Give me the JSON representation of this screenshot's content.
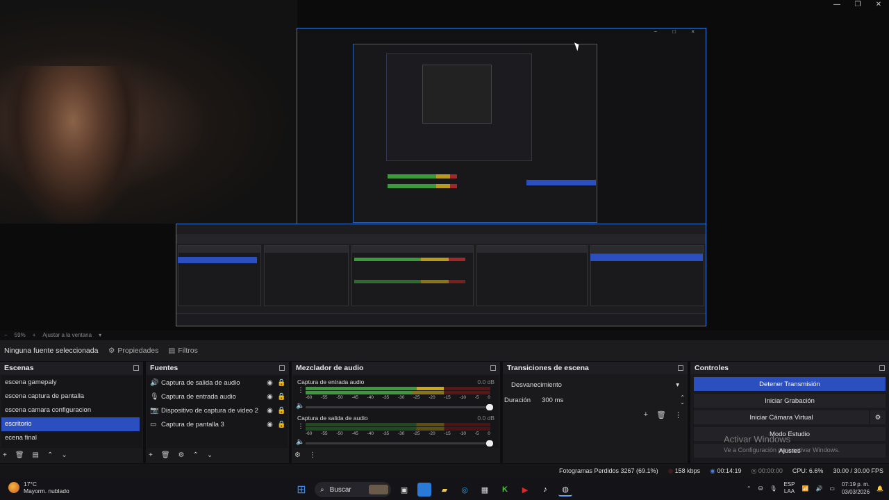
{
  "window": {
    "controls": [
      "—",
      "❐",
      "✕"
    ]
  },
  "zoom": {
    "minus": "−",
    "value": "59%",
    "plus": "+",
    "fit_label": "Ajustar a la ventana",
    "caret": "▾"
  },
  "source_toolbar": {
    "no_source": "Ninguna fuente seleccionada",
    "properties": "Propiedades",
    "filters": "Filtros"
  },
  "scenes": {
    "title": "Escenas",
    "items": [
      "escena gamepaly",
      "escena captura de pantalla",
      "escena camara configuracion",
      "escritorio",
      "ecena final"
    ],
    "active_index": 3
  },
  "sources": {
    "title": "Fuentes",
    "items": [
      {
        "label": "Captura de salida de audio",
        "icon": "speaker-icon"
      },
      {
        "label": "Captura de entrada audio",
        "icon": "microphone-icon"
      },
      {
        "label": "Dispositivo de captura de video 2",
        "icon": "camera-icon"
      },
      {
        "label": "Captura de pantalla 3",
        "icon": "monitor-icon"
      }
    ]
  },
  "mixer": {
    "title": "Mezclador de audio",
    "channels": [
      {
        "name": "Captura de entrada audio",
        "db": "0.0 dB",
        "level": 0.75
      },
      {
        "name": "Captura de salida de audio",
        "db": "0.0 dB",
        "level": 0.0
      }
    ],
    "ticks": [
      "-60",
      "-55",
      "-50",
      "-45",
      "-40",
      "-35",
      "-30",
      "-25",
      "-20",
      "-15",
      "-10",
      "-5",
      "0"
    ]
  },
  "transitions": {
    "title": "Transiciones de escena",
    "selected": "Desvanecimiento",
    "duration_label": "Duración",
    "duration_value": "300 ms"
  },
  "controls": {
    "title": "Controles",
    "stop_stream": "Detener Transmisión",
    "start_recording": "Iniciar Grabación",
    "virtual_camera": "Iniciar Cámara Virtual",
    "studio_mode": "Modo Estudio",
    "settings": "Ajustes",
    "watermark_title": "Activar Windows",
    "watermark_sub": "Ve a Configuración para activar Windows."
  },
  "status": {
    "dropped_frames": "Fotogramas Perdidos 3267 (69.1%)",
    "bitrate": "158 kbps",
    "stream_time": "00:14:19",
    "rec_time": "00:00:00",
    "cpu": "CPU: 6.6%",
    "fps": "30.00 / 30.00 FPS"
  },
  "taskbar": {
    "temperature": "17°C",
    "weather": "Mayorm. nublado",
    "search": "Buscar",
    "lang1": "ESP",
    "lang2": "LAA",
    "time": "07:19 p. m.",
    "date": "03/03/2026"
  },
  "colors": {
    "accent": "#2c4fc0",
    "meter_green": "#3c9a3c",
    "meter_yellow": "#c8a81e",
    "meter_red": "#a02828"
  }
}
